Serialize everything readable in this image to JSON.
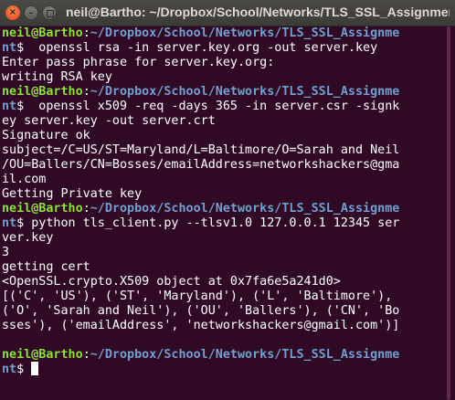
{
  "window": {
    "title": "neil@Bartho: ~/Dropbox/School/Networks/TLS_SSL_Assignment",
    "close_glyph": "×",
    "minimize_glyph": "–"
  },
  "prompt": {
    "user": "neil@Bartho",
    "separator": ":",
    "path": "~/Dropbox/School/Networks/TLS_SSL_Assignme",
    "path_wrap": "nt",
    "symbol": "$ "
  },
  "lines": [
    {
      "kind": "prompt",
      "cont": "nt$  openssl rsa -in server.key.org -out server.key"
    },
    {
      "kind": "out",
      "text": "Enter pass phrase for server.key.org:"
    },
    {
      "kind": "out",
      "text": "writing RSA key"
    },
    {
      "kind": "prompt",
      "cont": "nt$  openssl x509 -req -days 365 -in server.csr -signk"
    },
    {
      "kind": "out",
      "text": "ey server.key -out server.crt"
    },
    {
      "kind": "out",
      "text": "Signature ok"
    },
    {
      "kind": "out",
      "text": "subject=/C=US/ST=Maryland/L=Baltimore/O=Sarah and Neil"
    },
    {
      "kind": "out",
      "text": "/OU=Ballers/CN=Bosses/emailAddress=networkshackers@gma"
    },
    {
      "kind": "out",
      "text": "il.com"
    },
    {
      "kind": "out",
      "text": "Getting Private key"
    },
    {
      "kind": "prompt",
      "cont": "nt$ python tls_client.py --tlsv1.0 127.0.0.1 12345 ser"
    },
    {
      "kind": "out",
      "text": "ver.key"
    },
    {
      "kind": "out",
      "text": "3"
    },
    {
      "kind": "out",
      "text": "getting cert"
    },
    {
      "kind": "out",
      "text": "<OpenSSL.crypto.X509 object at 0x7fa6e5a241d0>"
    },
    {
      "kind": "out",
      "text": "[('C', 'US'), ('ST', 'Maryland'), ('L', 'Baltimore'),"
    },
    {
      "kind": "out",
      "text": "('O', 'Sarah and Neil'), ('OU', 'Ballers'), ('CN', 'Bo"
    },
    {
      "kind": "out",
      "text": "sses'), ('emailAddress', 'networkshackers@gmail.com')]"
    },
    {
      "kind": "out",
      "text": ""
    },
    {
      "kind": "prompt",
      "cont": "nt$ ",
      "cursor": true
    }
  ]
}
